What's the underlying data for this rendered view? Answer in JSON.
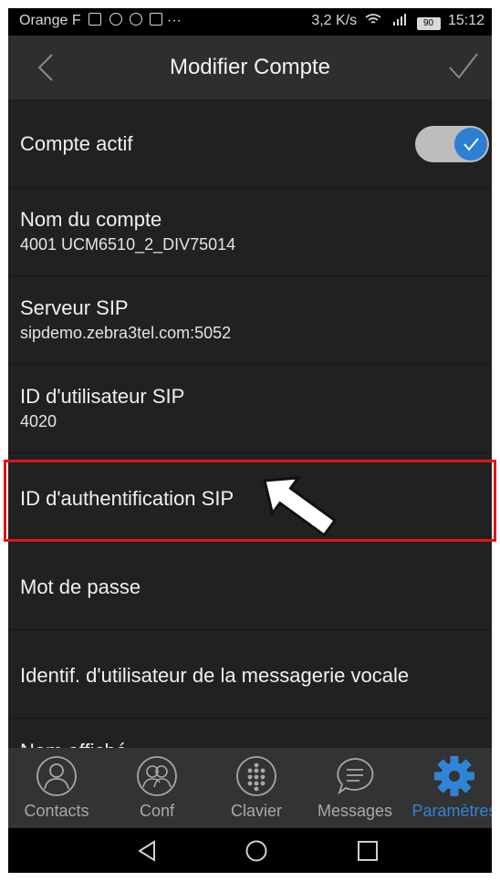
{
  "status_bar": {
    "carrier": "Orange F",
    "speed": "3,2 K/s",
    "battery": "90",
    "time": "15:12"
  },
  "header": {
    "title": "Modifier Compte"
  },
  "settings": [
    {
      "label": "Compte actif",
      "value": ""
    },
    {
      "label": "Nom du compte",
      "value": "4001 UCM6510_2_DIV75014"
    },
    {
      "label": "Serveur SIP",
      "value": "sipdemo.zebra3tel.com:5052"
    },
    {
      "label": "ID d'utilisateur SIP",
      "value": "4020"
    },
    {
      "label": "ID d'authentification SIP",
      "value": ""
    },
    {
      "label": "Mot de passe",
      "value": ""
    },
    {
      "label": "Identif. d'utilisateur de la messagerie vocale",
      "value": ""
    },
    {
      "label": "Nom affiché",
      "value": ""
    }
  ],
  "toggle": {
    "state": "on"
  },
  "tabs": [
    {
      "label": "Contacts",
      "icon": "person-icon"
    },
    {
      "label": "Conf",
      "icon": "group-icon"
    },
    {
      "label": "Clavier",
      "icon": "dialpad-icon"
    },
    {
      "label": "Messages",
      "icon": "chat-icon"
    },
    {
      "label": "Paramètres",
      "icon": "gear-icon"
    }
  ],
  "colors": {
    "accent": "#2f84d8",
    "highlight": "#e31414",
    "background": "#212121"
  }
}
